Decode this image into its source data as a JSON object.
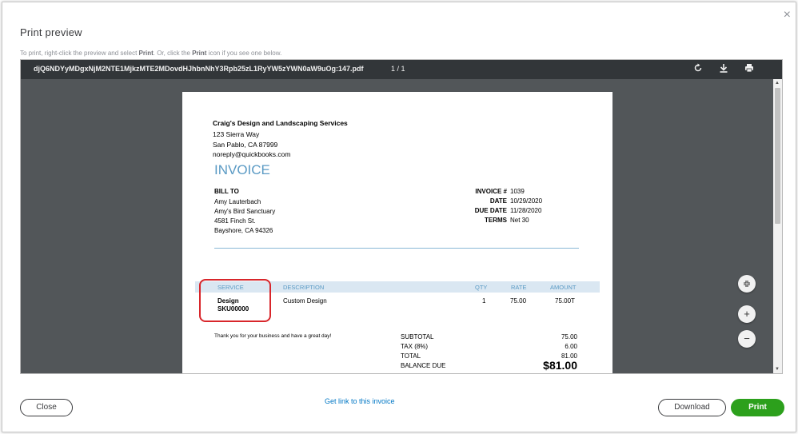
{
  "dialog": {
    "title": "Print preview",
    "close_symbol": "×",
    "instructions_pre": "To print, right-click the preview and select ",
    "instructions_print1": "Print",
    "instructions_mid": ". Or, click the ",
    "instructions_print2": "Print",
    "instructions_post": " icon if you see one below."
  },
  "viewer": {
    "filename": "djQ6NDYyMDgxNjM2NTE1MjkzMTE2MDovdHJhbnNhY3Rpb25zL1RyYW5zYWN0aW9uOg:147.pdf",
    "page_count": "1 / 1",
    "icons": [
      "rotate-icon",
      "download-icon",
      "print-icon"
    ]
  },
  "invoice": {
    "company": "Craig's Design and Landscaping Services",
    "address": [
      "123 Sierra Way",
      "San Pablo, CA  87999",
      "noreply@quickbooks.com"
    ],
    "title": "INVOICE",
    "bill_to_label": "BILL TO",
    "bill_to": [
      "Amy Lauterbach",
      "Amy's Bird Sanctuary",
      "4581 Finch St.",
      "Bayshore, CA  94326"
    ],
    "meta": [
      {
        "label": "INVOICE #",
        "value": "1039"
      },
      {
        "label": "DATE",
        "value": "10/29/2020"
      },
      {
        "label": "DUE DATE",
        "value": "11/28/2020"
      },
      {
        "label": "TERMS",
        "value": "Net 30"
      }
    ],
    "columns": [
      "SERVICE",
      "DESCRIPTION",
      "QTY",
      "RATE",
      "AMOUNT"
    ],
    "line": {
      "service_name": "Design",
      "service_sku": "SKU00000",
      "description": "Custom Design",
      "qty": "1",
      "rate": "75.00",
      "amount": "75.00T"
    },
    "thanks": "Thank you for your business and have a great day!",
    "totals": [
      {
        "label": "SUBTOTAL",
        "value": "75.00"
      },
      {
        "label": "TAX (8%)",
        "value": "6.00"
      },
      {
        "label": "TOTAL",
        "value": "81.00"
      }
    ],
    "balance_label": "BALANCE DUE",
    "balance_value": "$81.00"
  },
  "footer": {
    "close_label": "Close",
    "link_label": "Get link to this invoice",
    "download_label": "Download",
    "print_label": "Print"
  },
  "colors": {
    "accent_blue": "#5a9ac4",
    "print_green": "#2ca01c",
    "highlight_red": "#d8262b",
    "link_blue": "#0077c5"
  }
}
